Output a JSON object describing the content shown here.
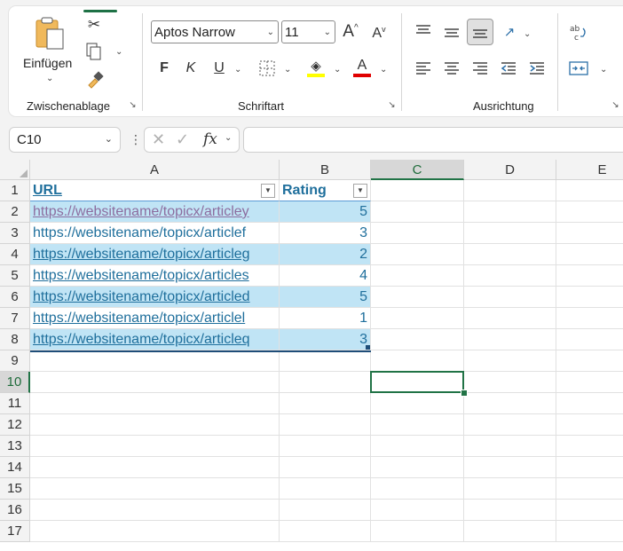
{
  "ribbon": {
    "clipboard": {
      "paste_label": "Einfügen",
      "group_label": "Zwischenablage"
    },
    "font": {
      "name": "Aptos Narrow",
      "size": "11",
      "bold": "F",
      "italic": "K",
      "underline": "U",
      "group_label": "Schriftart",
      "font_color": "#e00000",
      "fill_color": "#ffff00"
    },
    "alignment": {
      "group_label": "Ausrichtung"
    }
  },
  "formula_bar": {
    "name_box": "C10",
    "fx_label": "fx",
    "value": ""
  },
  "sheet": {
    "columns": [
      "A",
      "B",
      "C",
      "D",
      "E"
    ],
    "active_column": "C",
    "rows": [
      "1",
      "2",
      "3",
      "4",
      "5",
      "6",
      "7",
      "8",
      "9",
      "10",
      "11",
      "12",
      "13",
      "14",
      "15",
      "16",
      "17"
    ],
    "active_row": "10",
    "table": {
      "headers": {
        "url": "URL",
        "rating": "Rating"
      },
      "data": [
        {
          "url": "https://websitename/topicx/articley",
          "rating": "5"
        },
        {
          "url": "https://websitename/topicx/articlef",
          "rating": "3"
        },
        {
          "url": "https://websitename/topicx/articleg",
          "rating": "2"
        },
        {
          "url": "https://websitename/topicx/articles",
          "rating": "4"
        },
        {
          "url": "https://websitename/topicx/articled",
          "rating": "5"
        },
        {
          "url": "https://websitename/topicx/articlel",
          "rating": "1"
        },
        {
          "url": "https://websitename/topicx/articleq",
          "rating": "3"
        }
      ]
    }
  }
}
